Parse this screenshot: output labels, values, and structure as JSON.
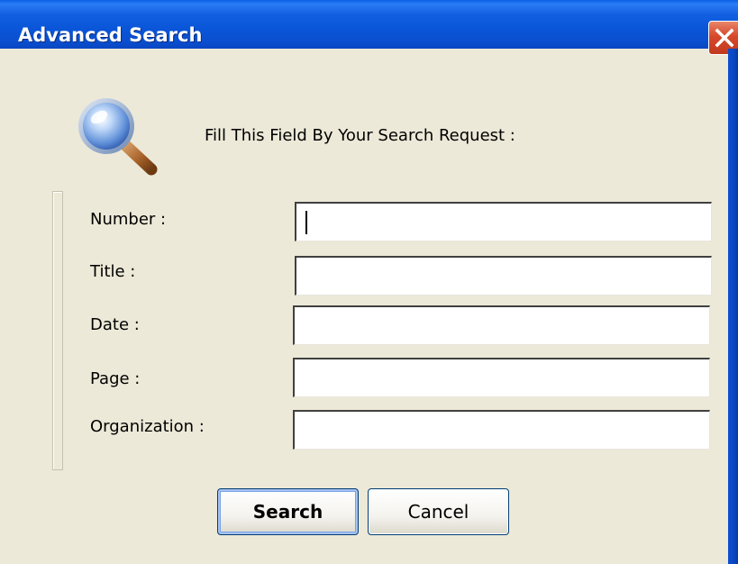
{
  "window": {
    "title": "Advanced Search",
    "close_label": "×"
  },
  "icon": {
    "name": "magnifying-glass-icon"
  },
  "prompt": "Fill This Field By Your Search Request :",
  "fields": [
    {
      "label": "Number :",
      "value": "",
      "placeholder": ""
    },
    {
      "label": "Title :",
      "value": "",
      "placeholder": ""
    },
    {
      "label": "Date :",
      "value": "",
      "placeholder": ""
    },
    {
      "label": "Page :",
      "value": "",
      "placeholder": ""
    },
    {
      "label": "Organization :",
      "value": "",
      "placeholder": ""
    }
  ],
  "buttons": {
    "search": "Search",
    "cancel": "Cancel"
  },
  "colors": {
    "titlebar": "#0a55d8",
    "dialog_bg": "#ece9d8",
    "close_button": "#d7482b",
    "default_button_focus": "#7aa2e6"
  }
}
